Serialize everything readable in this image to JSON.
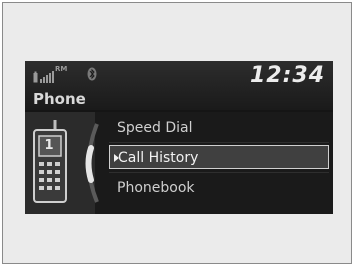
{
  "header": {
    "status_label": "RM",
    "title": "Phone",
    "clock": "12:34"
  },
  "menu": {
    "items": [
      {
        "label": "Speed Dial"
      },
      {
        "label": "Call History"
      },
      {
        "label": "Phonebook"
      }
    ],
    "selected": "Call History"
  },
  "phone_icon": {
    "keypad_label": "1"
  },
  "icons": {
    "signal": "signal-strength-icon",
    "bluetooth": "bluetooth-icon",
    "battery": "battery-icon",
    "phone": "phone-icon"
  },
  "colors": {
    "screen_bg": "#151515",
    "header_bg": "#2d2d2d",
    "text": "#d9d9d9",
    "highlight": "#404040"
  }
}
